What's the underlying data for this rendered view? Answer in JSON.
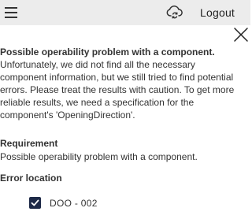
{
  "header": {
    "logout_label": "Logout"
  },
  "message": {
    "headline": "Possible operability problem with a component.",
    "body": "Unfortunately, we did not find all the necessary component information, but we still tried to find potential errors. Please treat the results with caution. To get more reliable results, we need a specification for the component's 'OpeningDirection'."
  },
  "requirement": {
    "title": "Requirement",
    "text": "Possible operability problem with a component."
  },
  "error_location": {
    "title": "Error location",
    "items": [
      {
        "label": "DOO - 002",
        "checked": true
      }
    ]
  },
  "colors": {
    "topbar": "#ececec",
    "checkbox": "#1e2a48"
  },
  "icons": [
    "menu-icon",
    "cloud-sync-icon",
    "close-icon",
    "check-icon"
  ]
}
